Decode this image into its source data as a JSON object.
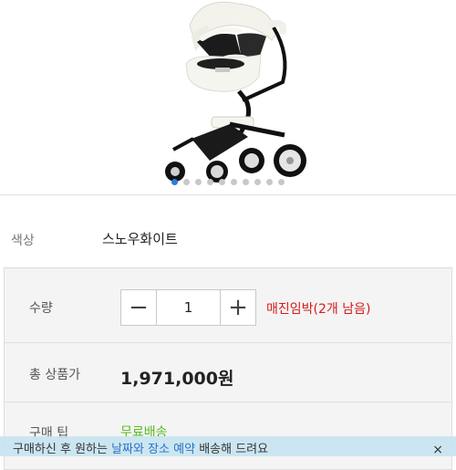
{
  "gallery": {
    "image_name": "stroller-snow-white",
    "slide_count": 10,
    "active_slide": 1
  },
  "options": {
    "color_label": "색상",
    "color_value": "스노우화이트"
  },
  "order": {
    "quantity_label": "수량",
    "quantity_value": "1",
    "minus_symbol": "−",
    "plus_symbol": "+",
    "stock_warning": "매진임박(2개 남음)",
    "total_label": "총 상품가",
    "total_value": "1,971,000원",
    "benefit_label": "구매 팁",
    "benefit_value": "무료배송"
  },
  "banner": {
    "text_prefix": "구매하신 후 원하는 ",
    "text_highlight": "날짜와 장소 예약",
    "text_suffix": " 배송해 드려요",
    "close_symbol": "×"
  },
  "colors": {
    "accent": "#2b7de1",
    "warning": "#d61a1a",
    "benefit": "#5aba20"
  }
}
